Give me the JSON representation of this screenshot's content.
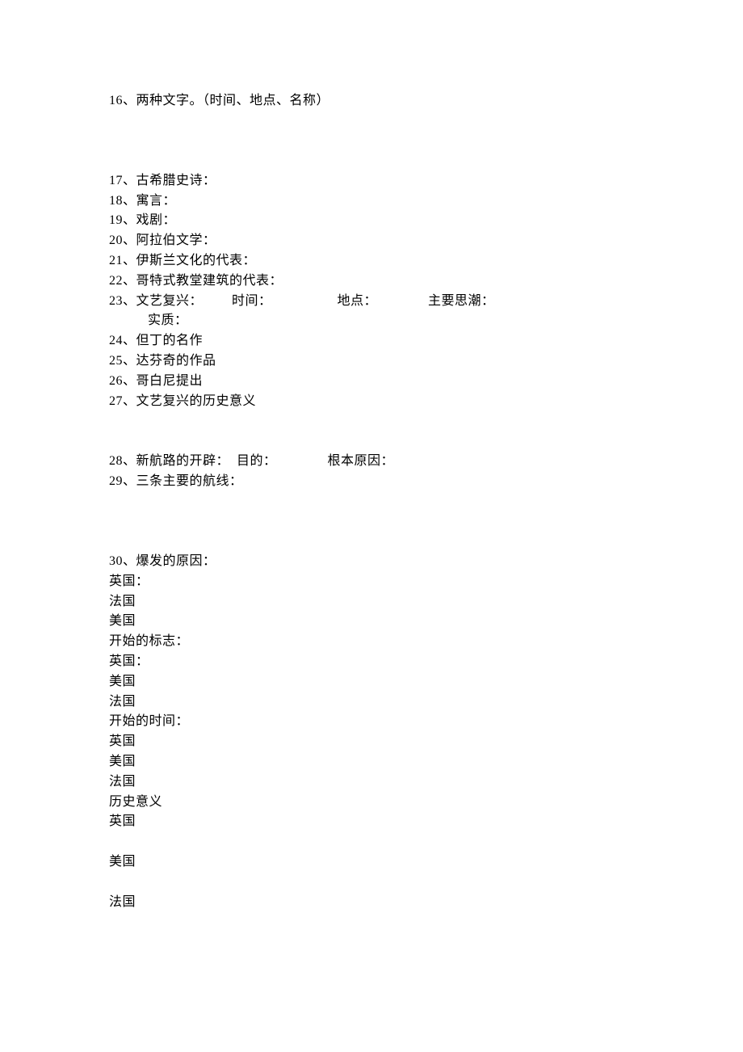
{
  "lines": {
    "q16": "16、两种文字。（时间、地点、名称）",
    "q17": "17、古希腊史诗：",
    "q18": "18、寓言：",
    "q19": "19、戏剧：",
    "q20": "20、阿拉伯文学：",
    "q21": "21、伊斯兰文化的代表：",
    "q22": "22、哥特式教堂建筑的代表：",
    "q23": "23、文艺复兴：        时间：                  地点：              主要思潮：",
    "q23b": "实质：",
    "q24": "24、但丁的名作",
    "q25": "25、达芬奇的作品",
    "q26": "26、哥白尼提出",
    "q27": "27、文艺复兴的历史意义",
    "q28": "28、新航路的开辟：  目的：              根本原因：",
    "q29": "29、三条主要的航线：",
    "q30": "30、爆发的原因：",
    "uk1": "英国：",
    "fr1": "法国",
    "us1": "美国",
    "startmark": "开始的标志：",
    "uk2": "英国：",
    "us2": "美国",
    "fr2": "法国",
    "starttime": "开始的时间：",
    "uk3": "英国",
    "us3": "美国",
    "fr3": "法国",
    "histmean": "历史意义",
    "uk4": "英国",
    "us4": "美国",
    "fr4": "法国"
  }
}
